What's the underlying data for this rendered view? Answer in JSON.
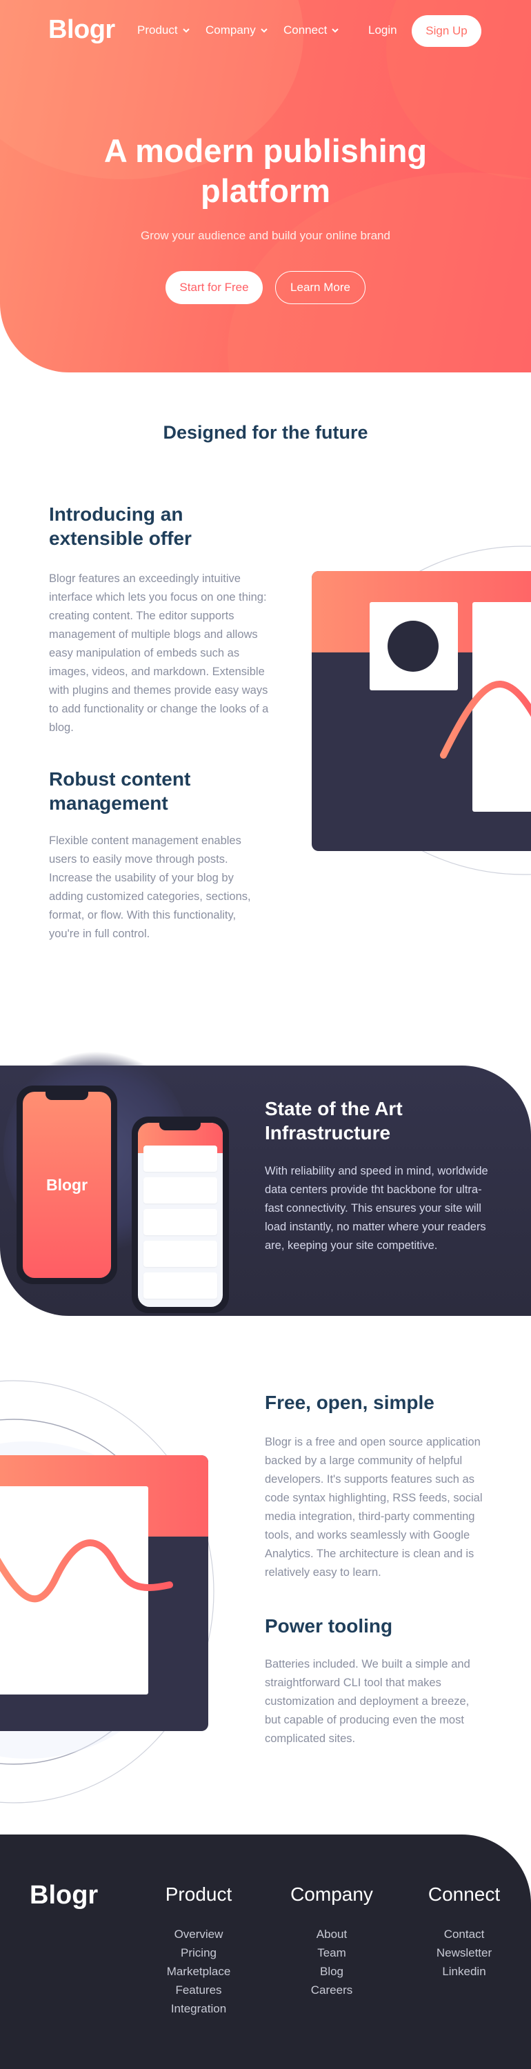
{
  "brand": {
    "logo": "Blogr"
  },
  "nav": {
    "items": [
      {
        "label": "Product"
      },
      {
        "label": "Company"
      },
      {
        "label": "Connect"
      }
    ],
    "login": "Login",
    "signup": "Sign Up"
  },
  "hero": {
    "title_line1": "A modern publishing",
    "title_line2": "platform",
    "subtitle": "Grow your audience and build your online brand",
    "primary_cta": "Start for Free",
    "secondary_cta": "Learn More"
  },
  "designed": {
    "title": "Designed for the future",
    "features": [
      {
        "heading_line1": "Introducing an",
        "heading_line2": "extensible offer",
        "text": "Blogr features an exceedingly intuitive interface which lets you focus on one thing: creating content. The editor supports management of multiple blogs and allows easy manipulation of embeds such as images, videos, and markdown. Extensible with plugins and themes provide easy ways to add functionality or change the looks of a blog."
      },
      {
        "heading_line1": "Robust content",
        "heading_line2": "management",
        "text": "Flexible content management enables users to easily move through posts. Increase the usability of your blog by adding customized categories, sections, format, or flow. With this functionality, you're in full control."
      }
    ]
  },
  "infrastructure": {
    "heading_line1": "State of the Art",
    "heading_line2": "Infrastructure",
    "text": "With reliability and speed in mind, worldwide data centers provide tht backbone for ultra-fast connectivity. This ensures your site will load instantly, no matter where your readers are, keeping your site competitive.",
    "phone_logo": "Blogr"
  },
  "simple": {
    "features": [
      {
        "heading": "Free, open, simple",
        "text": "Blogr is a free and open source application backed by a large community of helpful developers. It's supports features such as code syntax highlighting, RSS feeds, social media integration, third-party commenting tools, and works seamlessly with Google Analytics. The architecture is clean and is relatively easy to learn."
      },
      {
        "heading": "Power tooling",
        "text": "Batteries included. We built a simple and straightforward CLI tool that makes customization and deployment a breeze, but capable of producing even the most complicated sites."
      }
    ]
  },
  "footer": {
    "logo": "Blogr",
    "columns": [
      {
        "title": "Product",
        "links": [
          "Overview",
          "Pricing",
          "Marketplace",
          "Features",
          "Integration"
        ]
      },
      {
        "title": "Company",
        "links": [
          "About",
          "Team",
          "Blog",
          "Careers"
        ]
      },
      {
        "title": "Connect",
        "links": [
          "Contact",
          "Newsletter",
          "Linkedin"
        ]
      }
    ]
  },
  "colors": {
    "hero_gradient_start": "#ff8f72",
    "hero_gradient_end": "#ff5d64",
    "heading": "#1f3e5a",
    "body_text": "#8a8fa0",
    "dark_bg": "#2c2c3e",
    "footer_bg": "#242530"
  },
  "icons": [
    "chevron-down-icon"
  ]
}
